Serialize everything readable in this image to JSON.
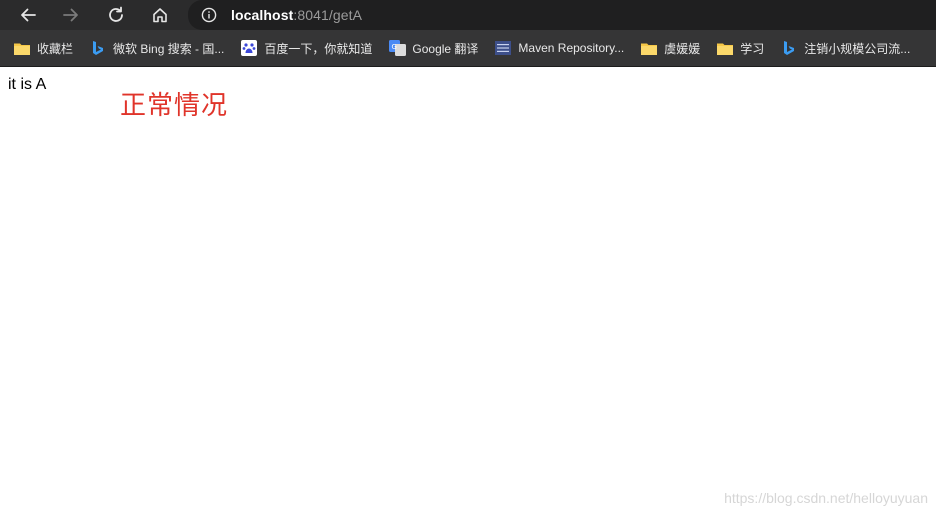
{
  "address_bar": {
    "host": "localhost",
    "path": ":8041/getA"
  },
  "bookmarks": [
    {
      "label": "收藏栏",
      "icon": "folder-icon"
    },
    {
      "label": "微软 Bing 搜索 - 国...",
      "icon": "bing-icon"
    },
    {
      "label": "百度一下，你就知道",
      "icon": "baidu-icon"
    },
    {
      "label": "Google 翻译",
      "icon": "google-translate-icon"
    },
    {
      "label": "Maven Repository...",
      "icon": "maven-icon"
    },
    {
      "label": "虞媛媛",
      "icon": "folder-icon"
    },
    {
      "label": "学习",
      "icon": "folder-icon"
    },
    {
      "label": "注销小规模公司流...",
      "icon": "bing-icon"
    }
  ],
  "page": {
    "body_text": "it is A",
    "annotation": "正常情况",
    "watermark": "https://blog.csdn.net/helloyuyuan"
  },
  "colors": {
    "toolbar": "#2b2b2c",
    "bookmarks_bar": "#353536",
    "annotation": "#e0342a"
  }
}
